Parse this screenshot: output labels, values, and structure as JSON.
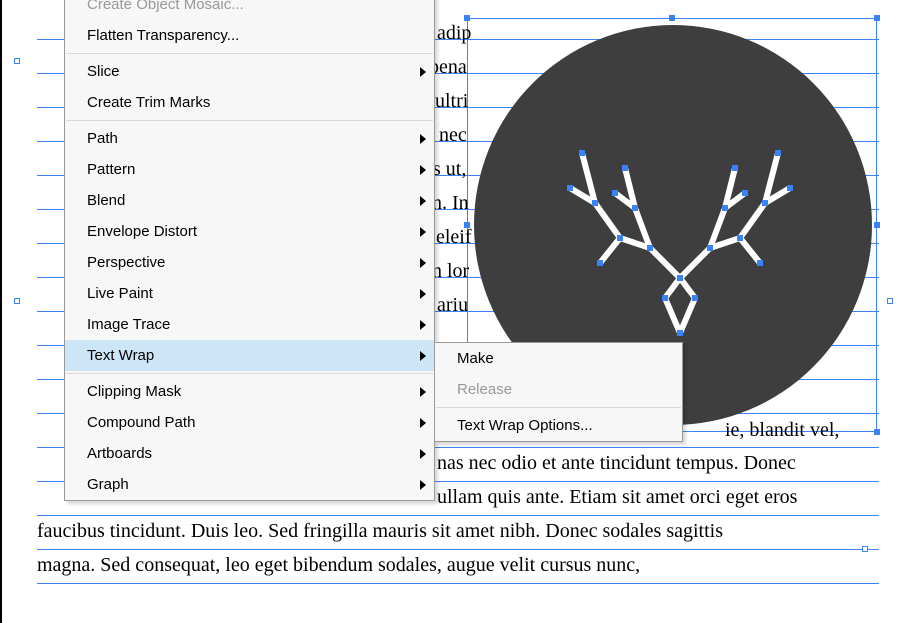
{
  "menu": {
    "main": [
      {
        "label": "Create Object Mosaic...",
        "disabled": true
      },
      {
        "label": "Flatten Transparency..."
      },
      "sep",
      {
        "label": "Slice",
        "submenu": true
      },
      {
        "label": "Create Trim Marks"
      },
      "sep",
      {
        "label": "Path",
        "submenu": true
      },
      {
        "label": "Pattern",
        "submenu": true
      },
      {
        "label": "Blend",
        "submenu": true
      },
      {
        "label": "Envelope Distort",
        "submenu": true
      },
      {
        "label": "Perspective",
        "submenu": true
      },
      {
        "label": "Live Paint",
        "submenu": true
      },
      {
        "label": "Image Trace",
        "submenu": true
      },
      {
        "label": "Text Wrap",
        "submenu": true,
        "highlight": true
      },
      "sep",
      {
        "label": "Clipping Mask",
        "submenu": true
      },
      {
        "label": "Compound Path",
        "submenu": true
      },
      {
        "label": "Artboards",
        "submenu": true
      },
      {
        "label": "Graph",
        "submenu": true
      }
    ],
    "sub": [
      {
        "label": "Make"
      },
      {
        "label": "Release",
        "disabled": true
      },
      "sep",
      {
        "label": "Text Wrap Options..."
      }
    ]
  },
  "body_text": {
    "l1_right": "adip",
    "l2_right": "pena",
    "l3_right": "ultri",
    "l4_right": "nec",
    "l5_right": "s ut,",
    "l6_right": "n. In",
    "l7_right": "eleif",
    "l8_right": "n lor",
    "l9_right": "ariu",
    "l13_suffix": "nas nec odio et ante tincidunt tempus. Donec",
    "l14_suffix": "ullam quis ante. Etiam sit amet orci eget eros",
    "l15": "faucibus tincidunt. Duis leo. Sed fringilla mauris sit amet nibh. Donec sodales sagittis",
    "l16": "magna. Sed consequat, leo eget bibendum sodales, augue velit cursus nunc,",
    "l13_hidden_word_end": "ie, blandit vel,"
  }
}
